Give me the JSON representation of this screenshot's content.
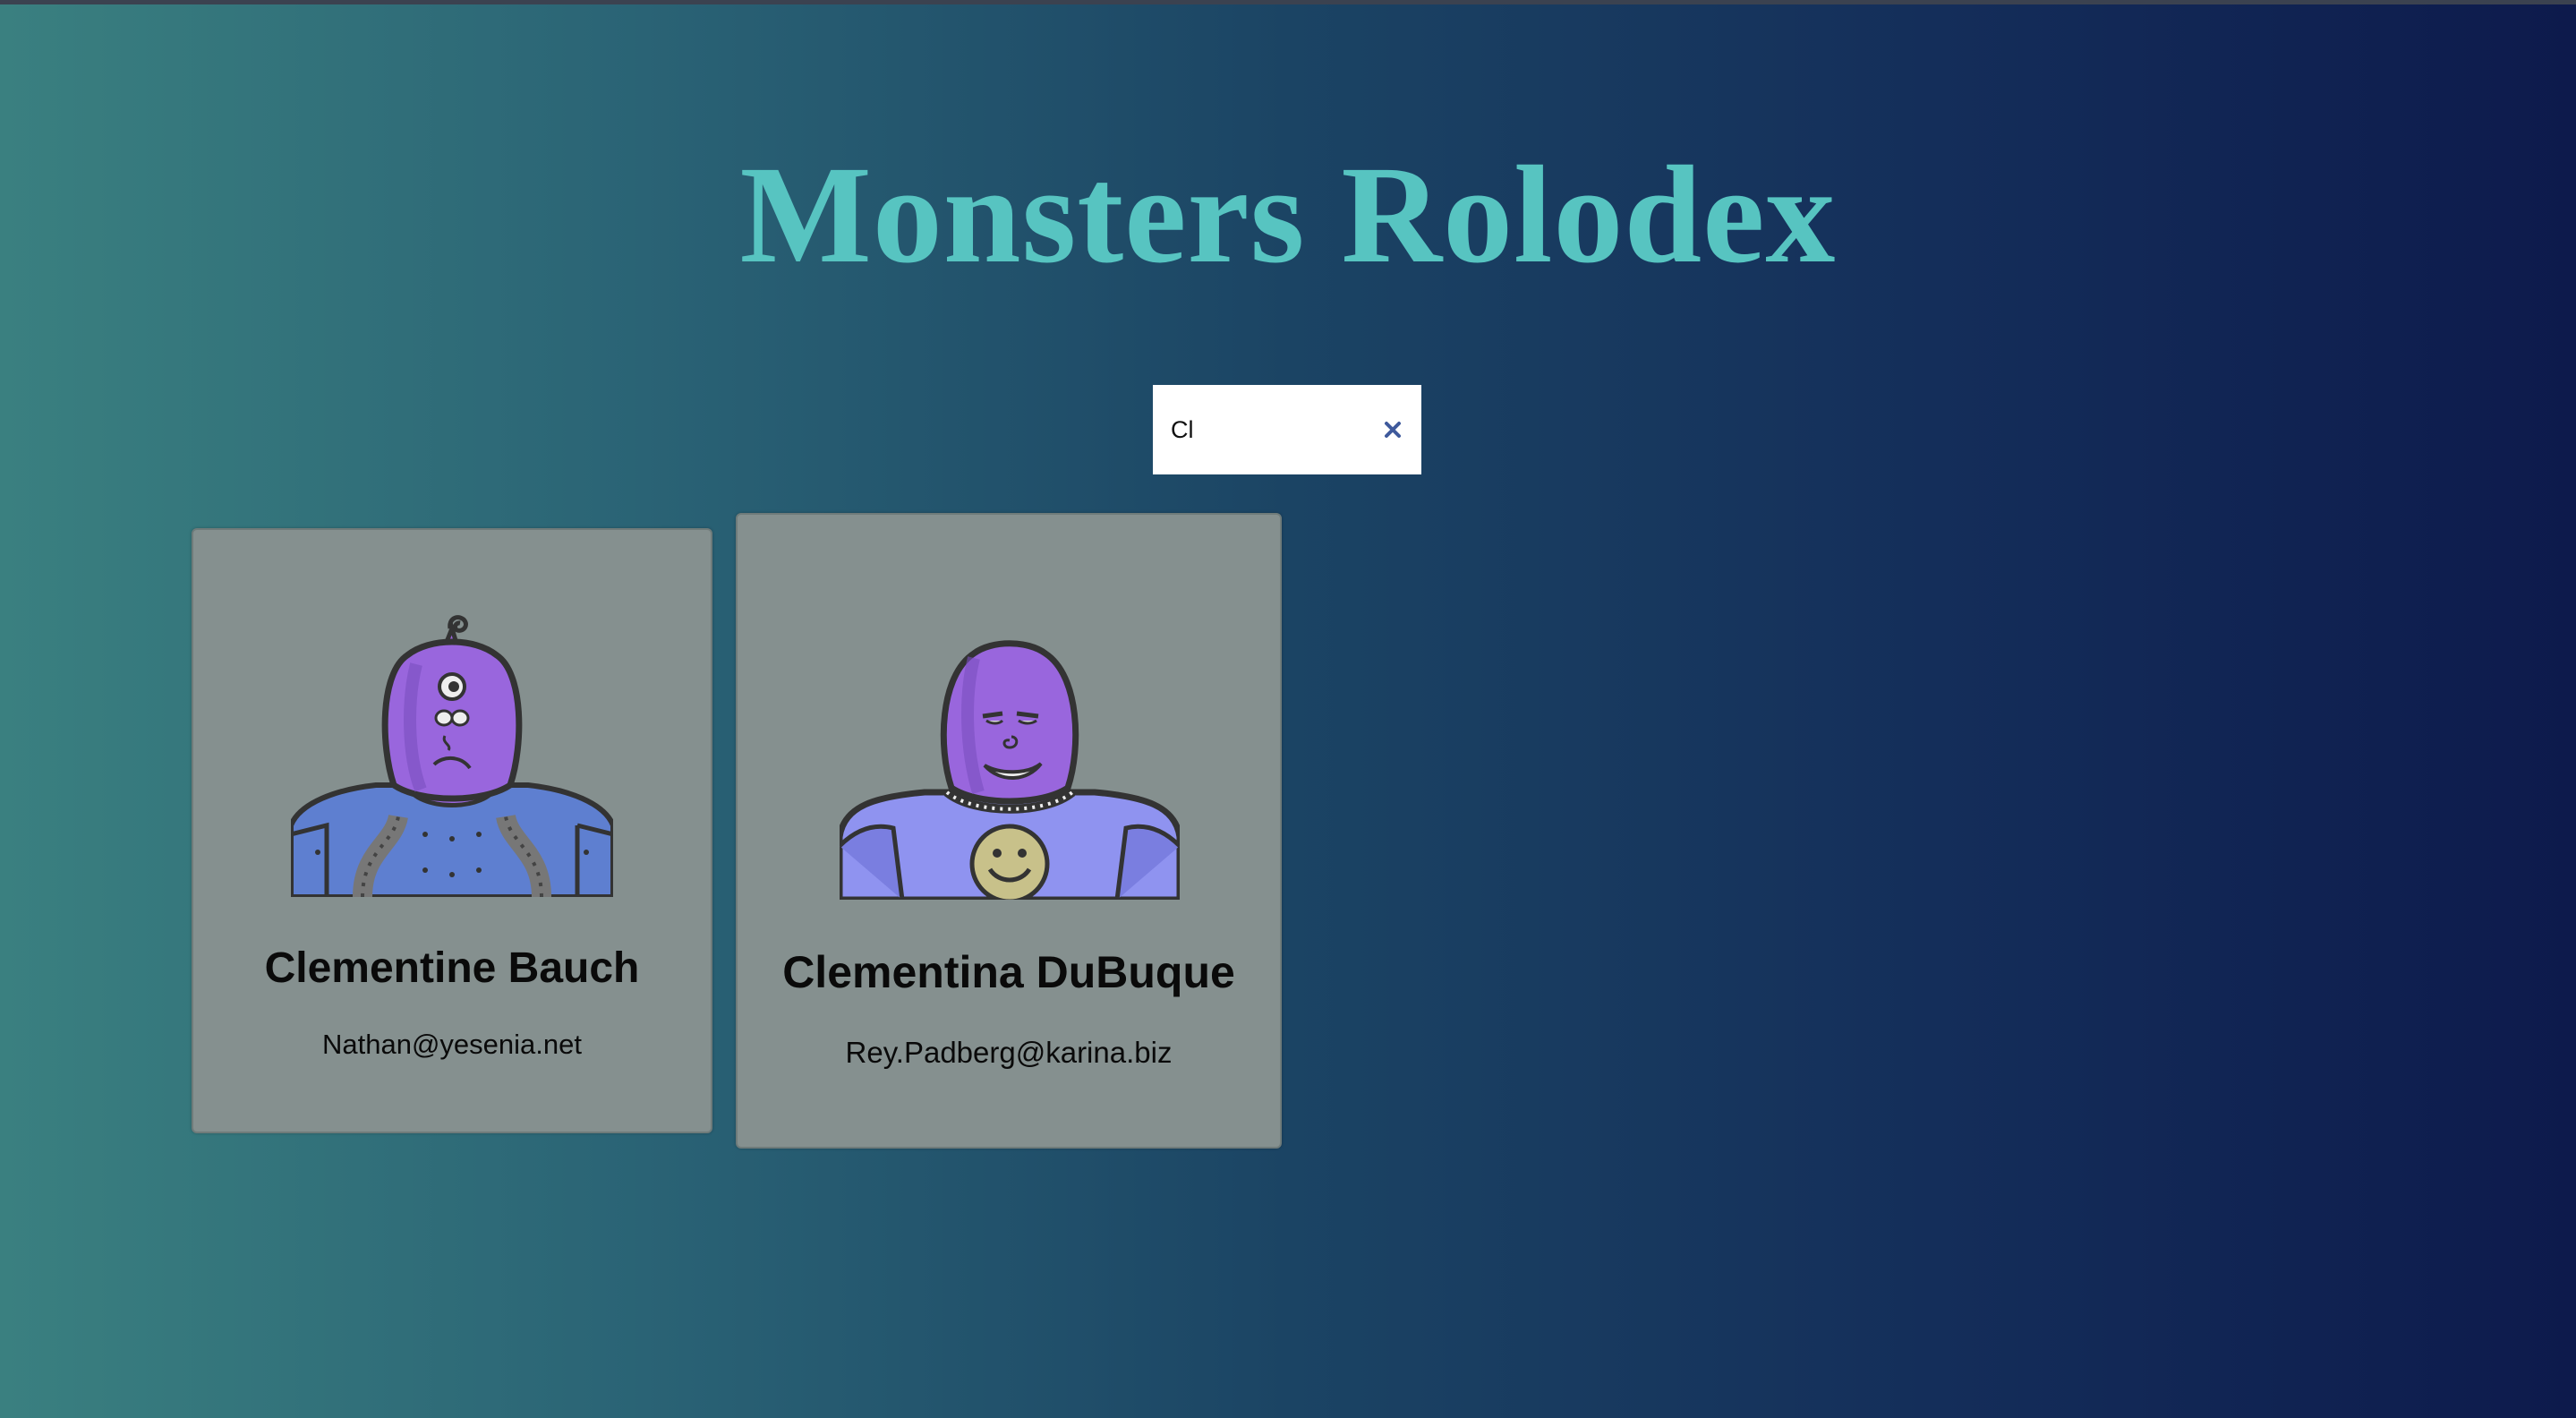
{
  "app": {
    "title": "Monsters Rolodex"
  },
  "search": {
    "value": "Cl",
    "clear_icon": "close-icon"
  },
  "monsters": [
    {
      "name": "Clementine Bauch",
      "email": "Nathan@yesenia.net",
      "avatar_icon": "robot-monster-avatar"
    },
    {
      "name": "Clementina DuBuque",
      "email": "Rey.Padberg@karina.biz",
      "avatar_icon": "robot-monster-avatar"
    }
  ],
  "colors": {
    "title": "#57c4c1",
    "card_background": "#85908f",
    "clear_icon": "#3f5a9c",
    "monster_purple": "#9966dd",
    "armor_blue": "#5e7fd0",
    "shirt_blue": "#8f93f0"
  }
}
